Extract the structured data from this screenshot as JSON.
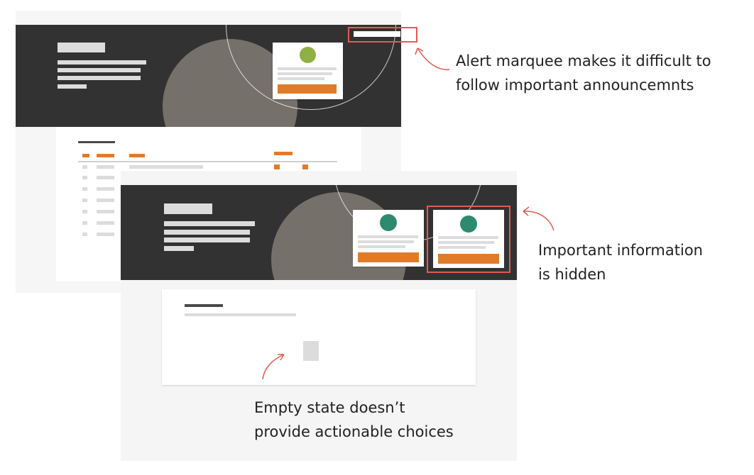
{
  "annotations": {
    "alert_marquee": "Alert marquee makes it difficult to\nfollow important announcemnts",
    "hidden_info": "Important information\nis hidden",
    "empty_state": "Empty state doesn’t\nprovide actionable choices"
  },
  "colors": {
    "hero_background": "#333232",
    "accent_orange": "#e07b2a",
    "highlight_red": "#e35a52",
    "avatar_green_light": "#8fb042",
    "avatar_green_dark": "#2e8a6c",
    "hero_circle": "#757069"
  },
  "icons": [
    "curved-arrow-icon",
    "avatar-icon",
    "empty-state-icon"
  ]
}
